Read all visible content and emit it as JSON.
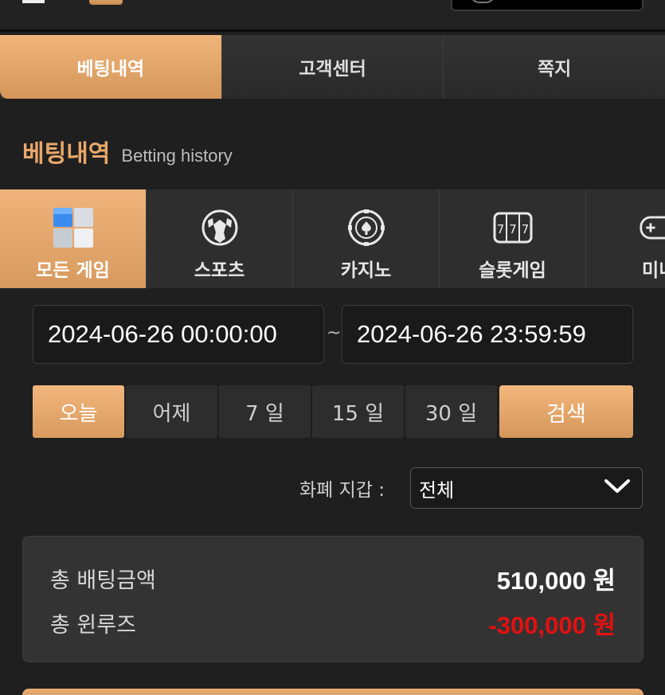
{
  "top_tabs": [
    {
      "label": "베팅내역",
      "active": true
    },
    {
      "label": "고객센터",
      "active": false
    },
    {
      "label": "쪽지",
      "active": false
    }
  ],
  "section": {
    "title": "베팅내역",
    "subtitle": "Betting history"
  },
  "categories": [
    {
      "label": "모든 게임",
      "icon": "all-games-cube-icon",
      "active": true
    },
    {
      "label": "스포츠",
      "icon": "soccer-ball-icon",
      "active": false
    },
    {
      "label": "카지노",
      "icon": "casino-chip-icon",
      "active": false
    },
    {
      "label": "슬롯게임",
      "icon": "slot-machine-icon",
      "active": false
    },
    {
      "label": "미니",
      "icon": "gamepad-icon",
      "active": false
    }
  ],
  "date_range": {
    "from": "2024-06-26 00:00:00",
    "separator": "~",
    "to": "2024-06-26 23:59:59"
  },
  "periods": [
    {
      "label": "오늘",
      "active": true
    },
    {
      "label": "어제",
      "active": false
    },
    {
      "label": "7 일",
      "active": false
    },
    {
      "label": "15 일",
      "active": false
    },
    {
      "label": "30 일",
      "active": false
    }
  ],
  "search_label": "검색",
  "currency": {
    "label": "화폐 지갑 :",
    "selected": "전체"
  },
  "summary": {
    "total_bet_label": "총 배팅금액",
    "total_bet_value": "510,000 원",
    "total_winloss_label": "총 윈루즈",
    "total_winloss_value": "-300,000 원"
  },
  "colors": {
    "accent": "#e8a76a",
    "negative": "#e41010",
    "background": "#1f1f1f"
  }
}
